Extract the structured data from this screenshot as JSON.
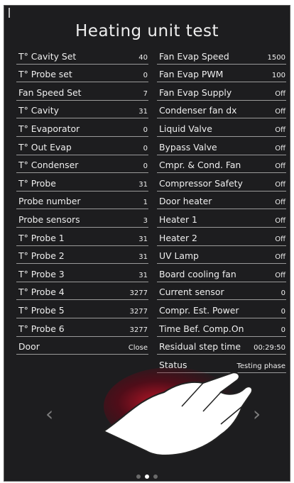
{
  "title": "Heating unit test",
  "left_params": [
    {
      "label": "T° Cavity Set",
      "value": "40"
    },
    {
      "label": "T° Probe set",
      "value": "0"
    },
    {
      "label": "Fan Speed Set",
      "value": "7"
    },
    {
      "label": "T° Cavity",
      "value": "31"
    },
    {
      "label": "T° Evaporator",
      "value": "0"
    },
    {
      "label": "T° Out Evap",
      "value": "0"
    },
    {
      "label": "T° Condenser",
      "value": "0"
    },
    {
      "label": "T° Probe",
      "value": "31"
    },
    {
      "label": "Probe number",
      "value": "1"
    },
    {
      "label": "Probe sensors",
      "value": "3"
    },
    {
      "label": "T° Probe 1",
      "value": "31"
    },
    {
      "label": "T° Probe 2",
      "value": "31"
    },
    {
      "label": "T° Probe 3",
      "value": "31"
    },
    {
      "label": "T° Probe 4",
      "value": "3277"
    },
    {
      "label": "T° Probe 5",
      "value": "3277"
    },
    {
      "label": "T° Probe 6",
      "value": "3277"
    },
    {
      "label": "Door",
      "value": "Close"
    }
  ],
  "right_params": [
    {
      "label": "Fan Evap Speed",
      "value": "1500"
    },
    {
      "label": "Fan Evap PWM",
      "value": "100"
    },
    {
      "label": "Fan Evap Supply",
      "value": "Off"
    },
    {
      "label": "Condenser fan dx",
      "value": "Off"
    },
    {
      "label": "Liquid Valve",
      "value": "Off"
    },
    {
      "label": "Bypass Valve",
      "value": "Off"
    },
    {
      "label": "Cmpr. & Cond. Fan",
      "value": "Off"
    },
    {
      "label": "Compressor Safety",
      "value": "Off"
    },
    {
      "label": "Door heater",
      "value": "Off"
    },
    {
      "label": "Heater 1",
      "value": "Off"
    },
    {
      "label": "Heater 2",
      "value": "Off"
    },
    {
      "label": "UV Lamp",
      "value": "Off"
    },
    {
      "label": "Board cooling fan",
      "value": "Off"
    },
    {
      "label": "Current sensor",
      "value": "0"
    },
    {
      "label": "Compr. Est. Power",
      "value": "0"
    },
    {
      "label": "Time Bef. Comp.On",
      "value": "0"
    },
    {
      "label": "Residual step time",
      "value": "00:29:50"
    },
    {
      "label": "Status",
      "value": "Testing phase"
    }
  ],
  "nav": {
    "prev_icon": "chevron-left-icon",
    "next_icon": "chevron-right-icon",
    "prev_glyph": "‹",
    "next_glyph": "›"
  },
  "pagination": {
    "count": 3,
    "active_index": 1
  },
  "colors": {
    "background": "#1d1d1f",
    "text": "#efefef",
    "divider": "#9a9a9a",
    "glow": "#d21428",
    "arrow": "#7c7c7c"
  }
}
